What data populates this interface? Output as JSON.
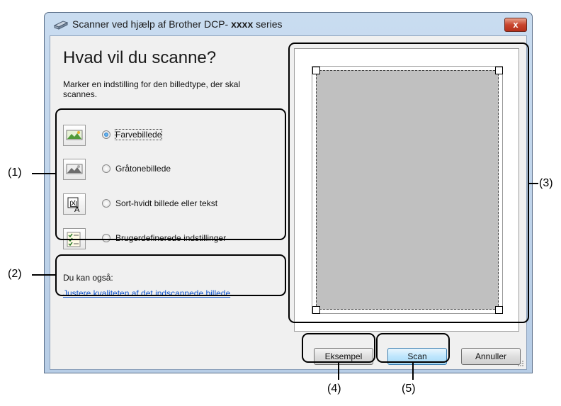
{
  "window": {
    "title_prefix": "Scanner ved hjælp af Brother DCP- ",
    "title_model": "xxxx",
    "title_suffix": " series",
    "close_label": "x"
  },
  "heading": "Hvad vil du scanne?",
  "instruction": "Marker en indstilling for den billedtype, der skal scannes.",
  "options": [
    {
      "label": "Farvebillede",
      "selected": true,
      "icon": "color-picture-icon"
    },
    {
      "label": "Gråtonebillede",
      "selected": false,
      "icon": "grayscale-picture-icon"
    },
    {
      "label": "Sort-hvidt billede eller tekst",
      "selected": false,
      "icon": "black-white-text-icon"
    },
    {
      "label": "Brugerdefinerede indstillinger",
      "selected": false,
      "icon": "custom-settings-icon"
    }
  ],
  "also": {
    "label": "Du kan også:",
    "link": "Justere kvaliteten af det indscannede billede"
  },
  "buttons": {
    "preview": "Eksempel",
    "scan": "Scan",
    "cancel": "Annuller"
  },
  "callouts": [
    "(1)",
    "(2)",
    "(3)",
    "(4)",
    "(5)"
  ]
}
